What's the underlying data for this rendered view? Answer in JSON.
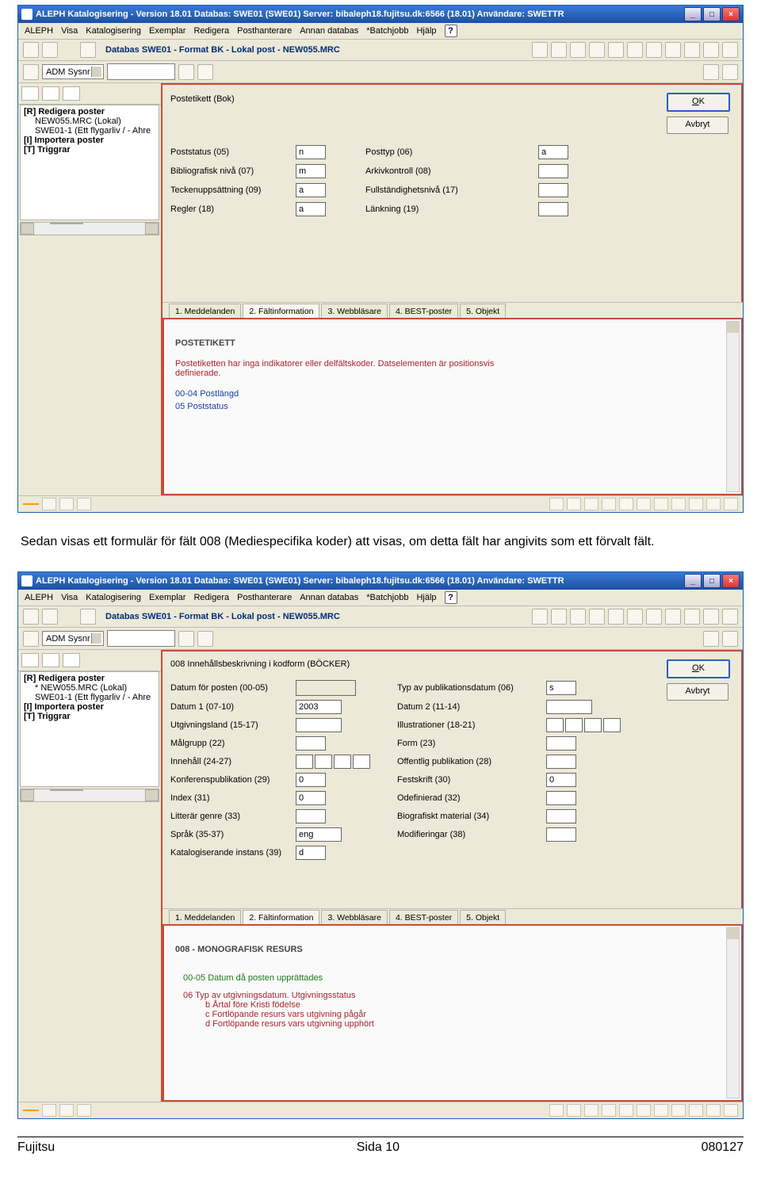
{
  "titlebar_text": "ALEPH Katalogisering - Version 18.01 Databas:  SWE01 (SWE01) Server:  bibaleph18.fujitsu.dk:6566 (18.01)  Användare:  SWETTR",
  "menubar": [
    "ALEPH",
    "Visa",
    "Katalogisering",
    "Exemplar",
    "Redigera",
    "Posthanterare",
    "Annan databas",
    "*Batchjobb",
    "Hjälp"
  ],
  "db_title": "Databas SWE01 - Format BK - Lokal post - NEW055.MRC",
  "dropdown_value": "ADM Sysnr",
  "tree": {
    "n0a": "[R] Redigera poster",
    "n1a": "NEW055.MRC (Lokal)",
    "n1b": "SWE01-1 (Ett flygarliv / - Ahre",
    "n0b": "[I] Importera poster",
    "n0c": "[T] Triggrar"
  },
  "tree2": {
    "n0a": "[R] Redigera poster",
    "n1a": "* NEW055.MRC (Lokal)",
    "n1b": "SWE01-1 (Ett flygarliv / - Ahre",
    "n0b": "[I] Importera poster",
    "n0c": "[T] Triggrar"
  },
  "btn_ok": "OK",
  "btn_cancel": "Avbryt",
  "form1": {
    "title": "Postetikett (Bok)",
    "rows": [
      {
        "l1": "Poststatus (05)",
        "v1": "n",
        "l2": "Posttyp (06)",
        "v2": "a"
      },
      {
        "l1": "Bibliografisk nivå (07)",
        "v1": "m",
        "l2": "Arkivkontroll (08)",
        "v2": ""
      },
      {
        "l1": "Teckenuppsättning (09)",
        "v1": "a",
        "l2": "Fullständighetsnivå (17)",
        "v2": ""
      },
      {
        "l1": "Regler (18)",
        "v1": "a",
        "l2": "Länkning (19)",
        "v2": ""
      }
    ]
  },
  "tabs": [
    "1. Meddelanden",
    "2. Fältinformation",
    "3. Webbläsare",
    "4. BEST-poster",
    "5. Objekt"
  ],
  "info1": {
    "heading": "POSTETIKETT",
    "text": "Postetiketten har inga indikatorer eller delfältskoder. Datselementen är positionsvis definierade.",
    "link1": "00-04 Postlängd",
    "link2": "05 Poststatus"
  },
  "midtext": "Sedan visas ett formulär för fält 008 (Mediespecifika koder) att visas, om detta fält har angivits som ett förvalt fält.",
  "form2": {
    "title": "008 Innehållsbeskrivning i kodform (BÖCKER)",
    "rows": [
      {
        "l1": "Datum för posten (00-05)",
        "t1": "long",
        "v1": "",
        "l2": "Typ av publikationsdatum (06)",
        "t2": "short",
        "v2": "s"
      },
      {
        "l1": "Datum 1 (07-10)",
        "t1": "med",
        "v1": "2003",
        "l2": "Datum 2 (11-14)",
        "t2": "med",
        "v2": ""
      },
      {
        "l1": "Utgivningsland (15-17)",
        "t1": "med",
        "v1": "",
        "l2": "Illustrationer (18-21)",
        "t2": "multi",
        "v2": ""
      },
      {
        "l1": "Målgrupp (22)",
        "t1": "short",
        "v1": "",
        "l2": "Form (23)",
        "t2": "short",
        "v2": ""
      },
      {
        "l1": "Innehåll (24-27)",
        "t1": "multi",
        "v1": "",
        "l2": "Offentlig publikation (28)",
        "t2": "short",
        "v2": ""
      },
      {
        "l1": "Konferenspublikation (29)",
        "t1": "short",
        "v1": "0",
        "l2": "Festskrift (30)",
        "t2": "short",
        "v2": "0"
      },
      {
        "l1": "Index (31)",
        "t1": "short",
        "v1": "0",
        "l2": "Odefinierad (32)",
        "t2": "short",
        "v2": ""
      },
      {
        "l1": "Litterär genre (33)",
        "t1": "short",
        "v1": "",
        "l2": "Biografiskt material (34)",
        "t2": "short",
        "v2": ""
      },
      {
        "l1": "Språk (35-37)",
        "t1": "med",
        "v1": "eng",
        "l2": "Modifieringar (38)",
        "t2": "short",
        "v2": ""
      },
      {
        "l1": "Katalogiserande instans (39)",
        "t1": "short",
        "v1": "d",
        "l2": "",
        "t2": "none",
        "v2": ""
      }
    ]
  },
  "info2": {
    "heading": "008 - MONOGRAFISK RESURS",
    "g1": "00-05   Datum då posten upprättades",
    "r1": "06     Typ av utgivningsdatum. Utgivningsstatus",
    "r2": "b  Årtal före Kristi födelse",
    "r3": "c  Fortlöpande resurs vars utgivning pågår",
    "r4": "d  Fortlöpande resurs vars utgivning upphört"
  },
  "footer": {
    "left": "Fujitsu",
    "center": "Sida 10",
    "right": "080127"
  }
}
